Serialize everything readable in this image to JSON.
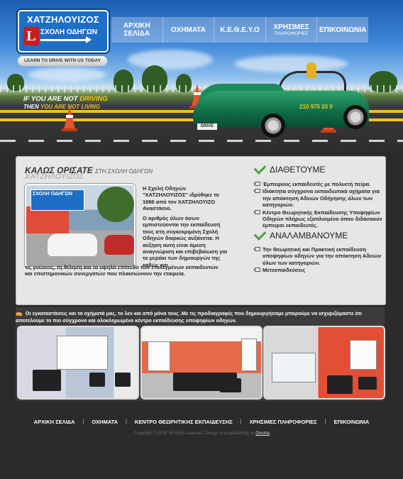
{
  "logo": {
    "name": "ΧΑΤΖΗΛΟΥΙΖΟΣ",
    "subtitle": "ΣΧΟΛΗ ΟΔΗΓΩΝ",
    "letter": "L",
    "slogan": "LEARN TO DRIVE WITH US TODAY"
  },
  "nav": [
    {
      "line1": "ΑΡΧΙΚΗ",
      "line2": "ΣΕΛΙΔΑ",
      "small": ""
    },
    {
      "line1": "ΟΧΗΜΑΤΑ",
      "line2": "",
      "small": ""
    },
    {
      "line1": "Κ.Ε.Θ.Ε.Υ.Ο",
      "line2": "",
      "small": ""
    },
    {
      "line1": "ΧΡΗΣΙΜΕΣ",
      "line2": "",
      "small": "ΠΛΗΡΟΦΟΡΙΕΣ"
    },
    {
      "line1": "ΕΠΙΚΟΙΝΩΝΙΑ",
      "line2": "",
      "small": ""
    }
  ],
  "banner": {
    "line1_a": "IF YOU ARE NOT",
    "line1_b": "DRIVING",
    "line2_a": "THEN",
    "line2_b": "YOU ARE NOT LIVING",
    "car_plate": "DRIVE",
    "car_phone": "210 975 20 9"
  },
  "welcome": {
    "title": "ΚΑΛΩΣ ΟΡΙΣΑΤΕ",
    "title_sub": "ΣΤΗ ΣΧΟΛΗ ΟΔΗΓΩΝ",
    "ghost": "ΧΑΤΖΗΛΟΥΙΖΟΣ",
    "photo_sign": "ΣΧΟΛΗ ΟΔΗΓΩΝ",
    "p1": "Η Σχολή Οδηγών \"ΧΑΤΖΗΛΟΥΙΖΟΣ\" ιδρύθηκε το 1986 από τον ΧΑΤΖΗΛΟΥΙΖΟ Αναστάσιο.",
    "p2": "Ο αριθμός όλων όσων εμπιστεύονται την εκπαίδευσή τους στη συγκεκριμένη Σχολή Οδηγών διαρκώς αυξάνεται. Η αύξηση αυτή είναι άμεση αναγνώριση και επιβεβαίωση για το μεράκι των δημιουργών της καθώς και",
    "p3": "τις γνώσεις, τη θέληση και το υψηλό επίπεδο των επιλεγμένων εκπαιδευτών και επιστημονικών συνεργατών που πλαισιώνουν την εταιρεία."
  },
  "offers": {
    "title": "ΔΙΑΘΕΤΟΥΜΕ",
    "items": [
      "Έμπειρους εκπαιδευτές με πολυετή πείρα.",
      "Ιδιόκτητα σύγχρονα εκπαιδευτικά οχήματα για την απόκτηση Αδειών Οδήγησης όλων των κατηγοριών.",
      "Κέντρο Θεωρητικής Εκπαίδευσης Υποψηφίων Οδηγών πλήρως εξοπλισμένο όπου διδάσκουν έμπειροι εκπαιδευτές."
    ]
  },
  "services": {
    "title": "ΑΝΑΛΑΜΒΑΝΟΥΜΕ",
    "items": [
      "Την Θεωρητική και Πρακτική εκπαίδευση υποψηφίων οδηγών για την απόκτηση Αδειών όλων των κατηγοριών.",
      "Μετεκπαιδεύσεις"
    ]
  },
  "facilities": {
    "text": "Οι εγκαταστάσεις και τα οχήματά μας, το λεν και από μόνα τους .Με τις προδιαγραφές που δημιουργήσαμε μπορούμε να ισχυριζόμαστε ότι αποτελούμε το πιο σύγχρονο και ολοκληρωμένο κέντρο εκπαίδευσης υποψηφίων οδηγών."
  },
  "footer": {
    "links": [
      "ΑΡΧΙΚΗ ΣΕΛΙΔΑ",
      "ΟΧΗΜΑΤΑ",
      "ΚΕΝΤΡΟ ΘΕΩΡΗΤΙΚΗΣ ΕΚΠΑΙΔΕΥΣΗΣ",
      "ΧΡΗΣΙΜΕΣ ΠΛΗΡΟΦΟΡΙΕΣ",
      "ΕΠΙΚΟΙΝΩΝΙΑ"
    ],
    "separator": "|",
    "copyright": "Copyright © 2008. All rights reserved. Design & programming by",
    "credit": "Onoma"
  },
  "colors": {
    "accent_yellow": "#f2c21a",
    "logo_blue": "#1d6ec7",
    "check_green": "#4aa23c"
  }
}
